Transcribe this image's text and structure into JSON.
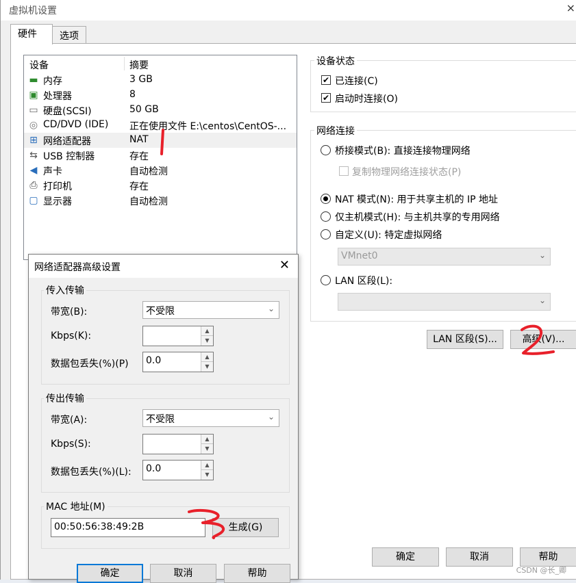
{
  "window": {
    "title": "虚拟机设置",
    "close_glyph": "×"
  },
  "tabs": [
    {
      "label": "硬件"
    },
    {
      "label": "选项"
    }
  ],
  "device_list": {
    "col_device": "设备",
    "col_summary": "摘要",
    "rows": [
      {
        "name": "内存",
        "summary": "3 GB",
        "icon": "memory-icon",
        "glyph": "▬"
      },
      {
        "name": "处理器",
        "summary": "8",
        "icon": "cpu-icon",
        "glyph": "▣"
      },
      {
        "name": "硬盘(SCSI)",
        "summary": "50 GB",
        "icon": "hdd-icon",
        "glyph": "▭"
      },
      {
        "name": "CD/DVD (IDE)",
        "summary": "正在使用文件 E:\\centos\\CentOS-...",
        "icon": "cd-icon",
        "glyph": "◎"
      },
      {
        "name": "网络适配器",
        "summary": "NAT",
        "icon": "network-icon",
        "glyph": "⊞"
      },
      {
        "name": "USB 控制器",
        "summary": "存在",
        "icon": "usb-icon",
        "glyph": "⇆"
      },
      {
        "name": "声卡",
        "summary": "自动检测",
        "icon": "speaker-icon",
        "glyph": "◀"
      },
      {
        "name": "打印机",
        "summary": "存在",
        "icon": "printer-icon",
        "glyph": "⎙"
      },
      {
        "name": "显示器",
        "summary": "自动检测",
        "icon": "monitor-icon",
        "glyph": "▢"
      }
    ]
  },
  "device_status": {
    "label": "设备状态",
    "connected": "已连接(C)",
    "connect_at_power_on": "启动时连接(O)"
  },
  "network_connection": {
    "label": "网络连接",
    "bridged": "桥接模式(B): 直接连接物理网络",
    "replicate": "复制物理网络连接状态(P)",
    "nat": "NAT 模式(N): 用于共享主机的 IP 地址",
    "host_only": "仅主机模式(H): 与主机共享的专用网络",
    "custom": "自定义(U): 特定虚拟网络",
    "custom_value": "VMnet0",
    "lan_segment": "LAN 区段(L):",
    "lan_value": ""
  },
  "buttons": {
    "lan_segments": "LAN 区段(S)...",
    "advanced": "高级(V)...",
    "ok": "确定",
    "cancel": "取消",
    "help": "帮助"
  },
  "dialog": {
    "title": "网络适配器高级设置",
    "close_glyph": "✕",
    "incoming": {
      "label": "传入传输",
      "bandwidth_label": "带宽(B):",
      "bandwidth_value": "不受限",
      "kbps_label": "Kbps(K):",
      "kbps_value": "",
      "loss_label": "数据包丢失(%)(P)",
      "loss_value": "0.0"
    },
    "outgoing": {
      "label": "传出传输",
      "bandwidth_label": "带宽(A):",
      "bandwidth_value": "不受限",
      "kbps_label": "Kbps(S):",
      "kbps_value": "",
      "loss_label": "数据包丢失(%)(L):",
      "loss_value": "0.0"
    },
    "mac": {
      "label": "MAC 地址(M)",
      "value": "00:50:56:38:49:2B",
      "generate": "生成(G)"
    },
    "ok": "确定",
    "cancel": "取消",
    "help": "帮助"
  },
  "watermark": "CSDN @长_卿",
  "colors": {
    "accent": "#0078d7",
    "annotation": "#e8202a"
  }
}
